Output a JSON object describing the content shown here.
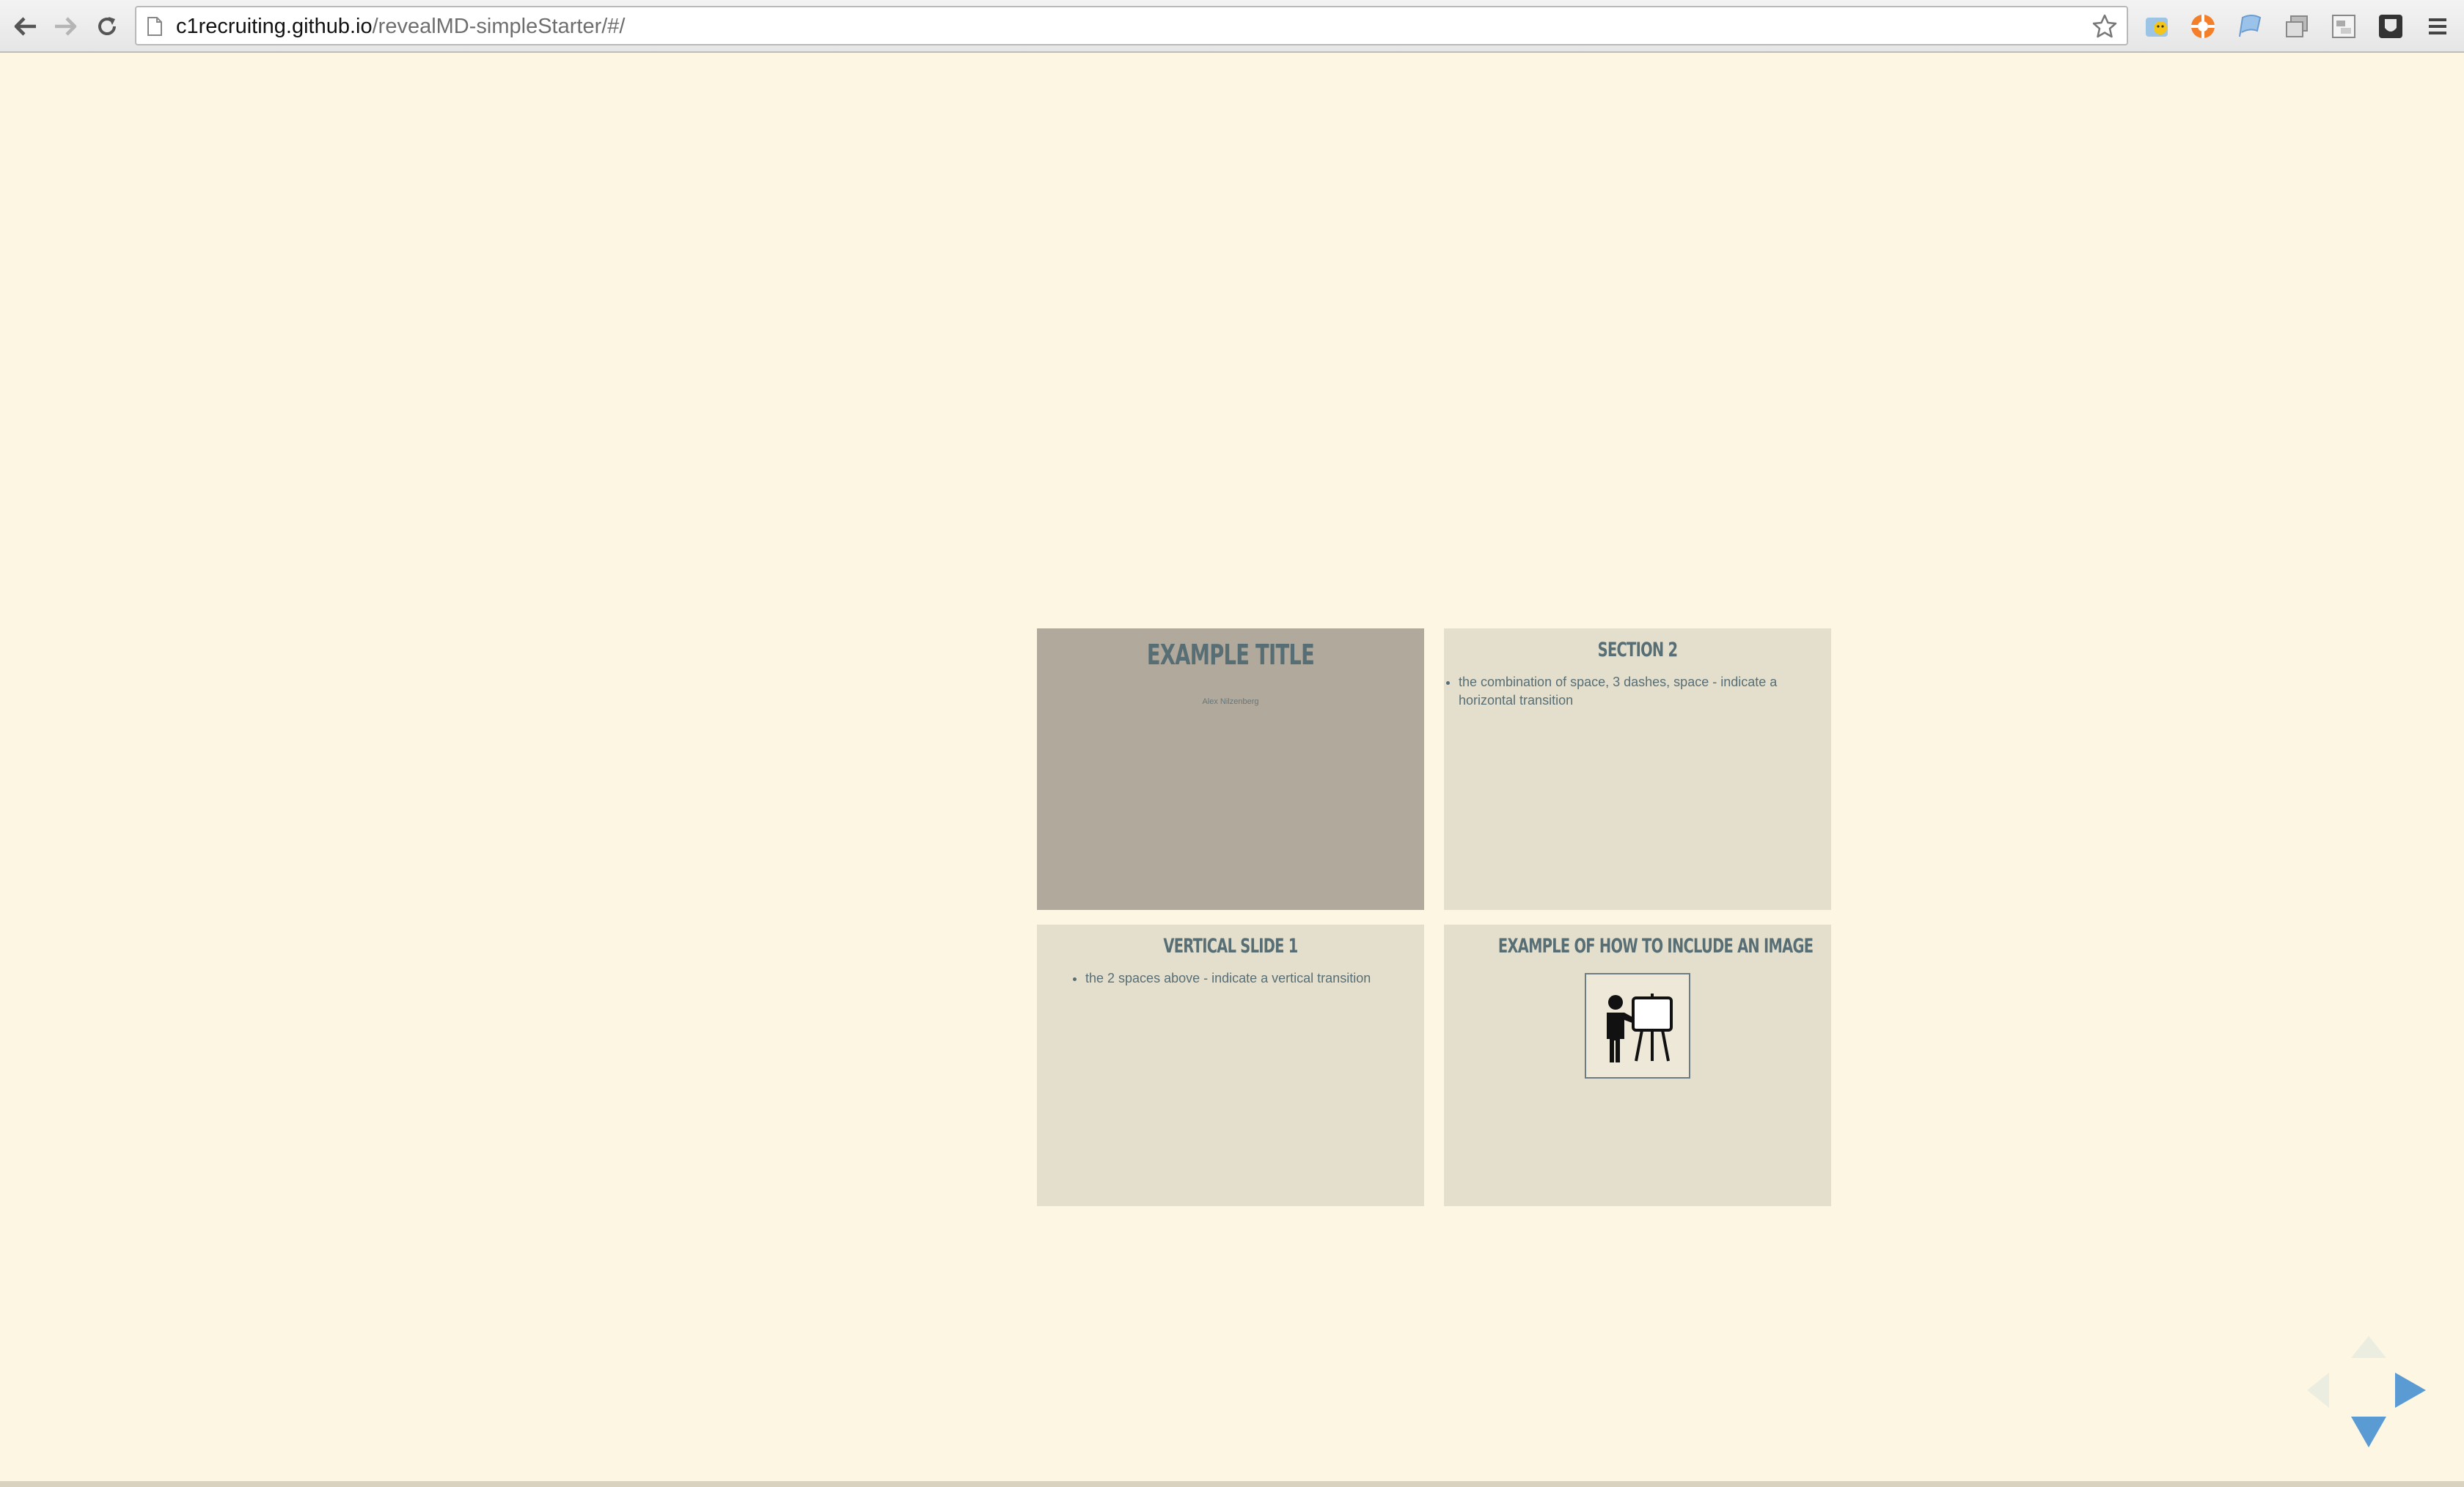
{
  "browser": {
    "url_host": "c1recruiting.github.io",
    "url_path": "/revealMD-simpleStarter/#/"
  },
  "slides": {
    "title_slide": {
      "title": "EXAMPLE TITLE",
      "author": "Alex Nilzenberg"
    },
    "section2": {
      "title": "SECTION 2",
      "bullets": [
        "the combination of space, 3 dashes, space - indicate a horizontal transition"
      ]
    },
    "vertical1": {
      "title": "VERTICAL SLIDE 1",
      "bullets": [
        "the 2 spaces above - indicate a vertical transition"
      ]
    },
    "image_slide": {
      "title": "EXAMPLE OF HOW TO INCLUDE AN IMAGE",
      "image_icon": "presenter-at-easel-icon"
    }
  },
  "controls": {
    "up_enabled": false,
    "left_enabled": false,
    "right_enabled": true,
    "down_enabled": true,
    "accent": "#5a9bd4"
  },
  "colors": {
    "background": "#fdf6e3",
    "slide_bg": "#e3dfcc",
    "active_slide_bg": "#b1a99c",
    "heading": "#586e75"
  }
}
